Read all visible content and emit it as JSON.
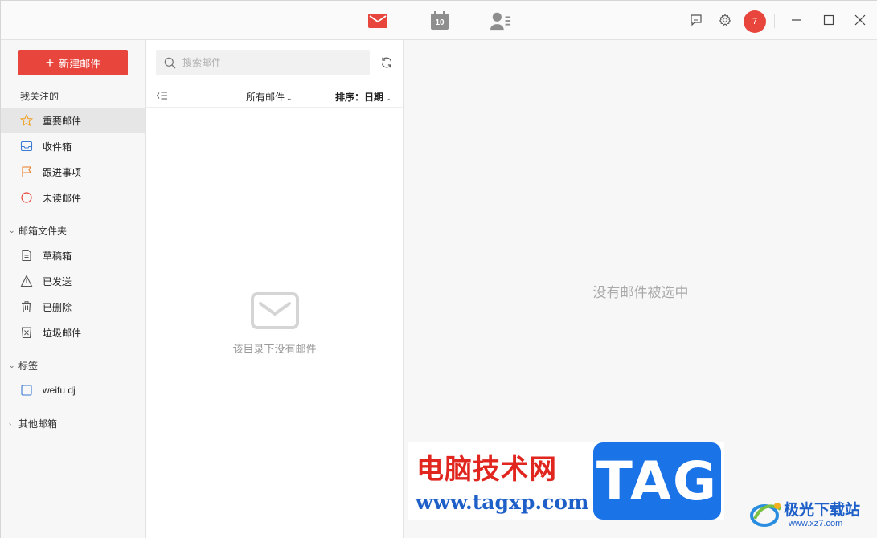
{
  "titlebar": {
    "tabs": [
      {
        "name": "mail",
        "icon": "mail-icon",
        "active": true
      },
      {
        "name": "calendar",
        "icon": "calendar-icon",
        "day": "10"
      },
      {
        "name": "contacts",
        "icon": "contacts-icon"
      }
    ],
    "avatar_text": "7",
    "accent_color": "#e8453c"
  },
  "sidebar": {
    "compose_label": "新建邮件",
    "favorites_title": "我关注的",
    "favorites": [
      {
        "label": "重要邮件",
        "icon": "star-icon",
        "active": true
      },
      {
        "label": "收件箱",
        "icon": "inbox-icon"
      },
      {
        "label": "跟进事项",
        "icon": "flag-icon"
      },
      {
        "label": "未读邮件",
        "icon": "unread-circle-icon"
      }
    ],
    "folders_title": "邮箱文件夹",
    "folders": [
      {
        "label": "草稿箱",
        "icon": "draft-icon"
      },
      {
        "label": "已发送",
        "icon": "sent-icon"
      },
      {
        "label": "已删除",
        "icon": "trash-icon"
      },
      {
        "label": "垃圾邮件",
        "icon": "spam-icon"
      }
    ],
    "tags_title": "标签",
    "tags": [
      {
        "label": "weifu dj",
        "icon": "tag-checkbox-icon"
      }
    ],
    "other_title": "其他邮箱"
  },
  "list": {
    "search_placeholder": "搜索邮件",
    "filter_label": "所有邮件",
    "sort_label": "排序：日期",
    "empty_text": "该目录下没有邮件"
  },
  "reader": {
    "empty_text": "没有邮件被选中"
  },
  "watermark": {
    "site_title": "电脑技术网",
    "site_url": "www.tagxp.com",
    "tag_text": "TAG",
    "brand2_title": "极光下载站",
    "brand2_url": "www.xz7.com"
  }
}
